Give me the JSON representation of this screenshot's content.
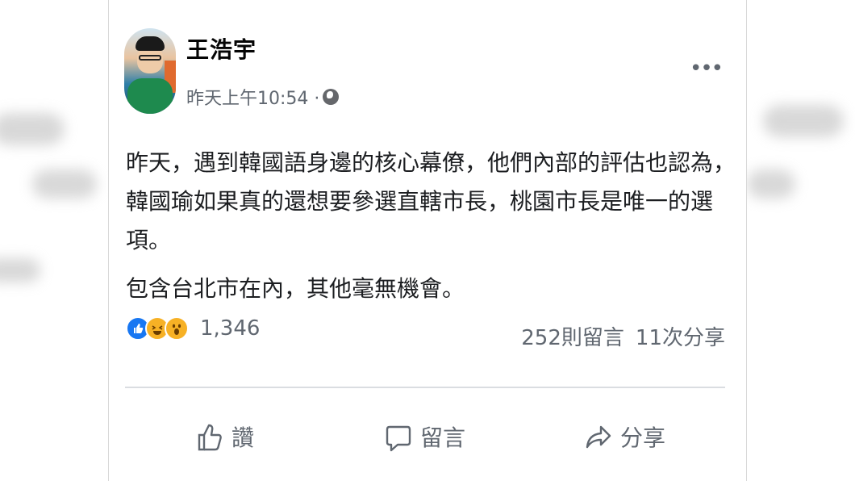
{
  "post": {
    "author": "王浩宇",
    "timestamp": "昨天上午10:54 ·",
    "privacy_icon": "globe-icon",
    "more_label": "•••",
    "paragraphs": [
      "昨天，遇到韓國語身邊的核心幕僚，他們內部的評估也認為，韓國瑜如果真的還想要參選直轄市長，桃園市長是唯一的選項。",
      "包含台北市在內，其他毫無機會。"
    ]
  },
  "reactions": {
    "icons": [
      "like-icon",
      "haha-icon",
      "wow-icon"
    ],
    "count": "1,346"
  },
  "stats": {
    "comments": "252則留言",
    "shares": "11次分享"
  },
  "actions": {
    "like_label": "讚",
    "comment_label": "留言",
    "share_label": "分享"
  },
  "colors": {
    "like_blue": "#1877f2",
    "emoji_yellow": "#f7b125",
    "secondary_text": "#606770"
  }
}
